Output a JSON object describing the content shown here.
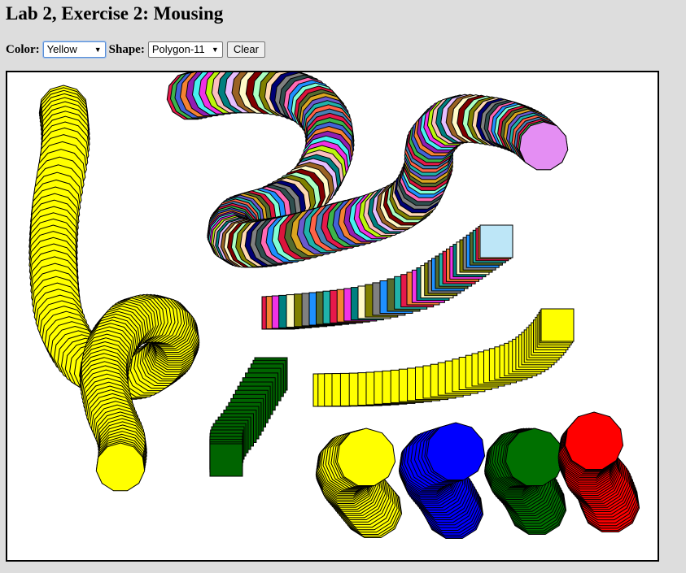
{
  "page": {
    "title": "Lab 2, Exercise 2: Mousing"
  },
  "controls": {
    "color_label": "Color:",
    "color_value": "Yellow",
    "shape_label": "Shape:",
    "shape_value": "Polygon-11",
    "clear_label": "Clear"
  },
  "canvas": {
    "background": "#ffffff",
    "border_color": "#000000",
    "palette_yellow": "#ffff00",
    "palette_blue": "#0000ff",
    "palette_green": "#007000",
    "palette_red": "#ff0000",
    "palette_lightblue": "#bde6f7",
    "palette_violet": "#e48ef3",
    "dark_green": "#006400"
  },
  "icons": {
    "dropdown": "chevron-down-icon"
  }
}
